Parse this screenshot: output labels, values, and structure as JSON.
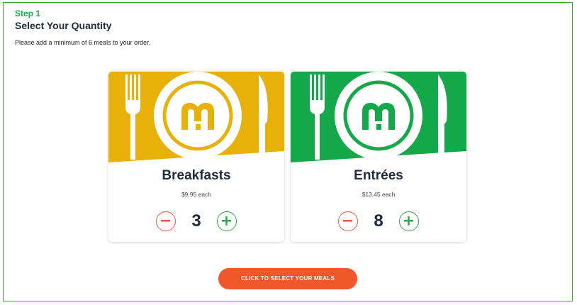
{
  "step_label": "Step 1",
  "title": "Select Your Quantity",
  "instructions": "Please add a minimum of 6 meals to your order.",
  "cards": [
    {
      "name": "Breakfasts",
      "price": "$9.95 each",
      "quantity": "3",
      "banner_color": "#e8b10a",
      "icons": [
        "fork-icon",
        "plate-logo-icon",
        "knife-icon",
        "minus-icon",
        "plus-icon"
      ]
    },
    {
      "name": "Entrées",
      "price": "$13.45 each",
      "quantity": "8",
      "banner_color": "#14a84a",
      "icons": [
        "fork-icon",
        "plate-logo-icon",
        "knife-icon",
        "minus-icon",
        "plus-icon"
      ]
    }
  ],
  "cta_label": "CLICK TO SELECT YOUR MEALS",
  "colors": {
    "frame_border": "#3f9a3a",
    "step_label": "#20a84a",
    "minus": "#e85a3a",
    "plus": "#2da84a",
    "cta": "#f0582c"
  }
}
